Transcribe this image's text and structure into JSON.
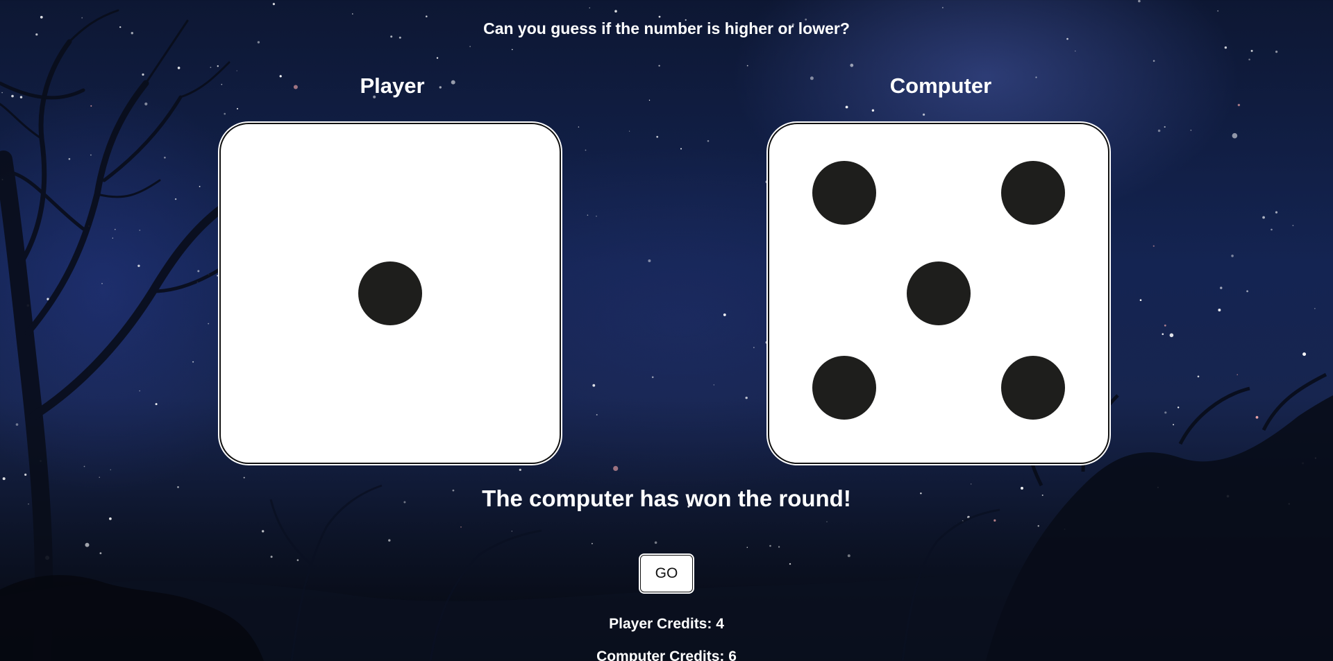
{
  "headline": "Can you guess if the number is higher or lower?",
  "player": {
    "label": "Player",
    "die_value": 1
  },
  "computer": {
    "label": "Computer",
    "die_value": 5
  },
  "result_message": "The computer has won the round!",
  "go_button_label": "GO",
  "credits": {
    "player": "Player Credits: 4",
    "computer": "Computer Credits: 6"
  },
  "colors": {
    "die_face": "#ffffff",
    "pip": "#1e1e1c",
    "text": "#ffffff"
  }
}
